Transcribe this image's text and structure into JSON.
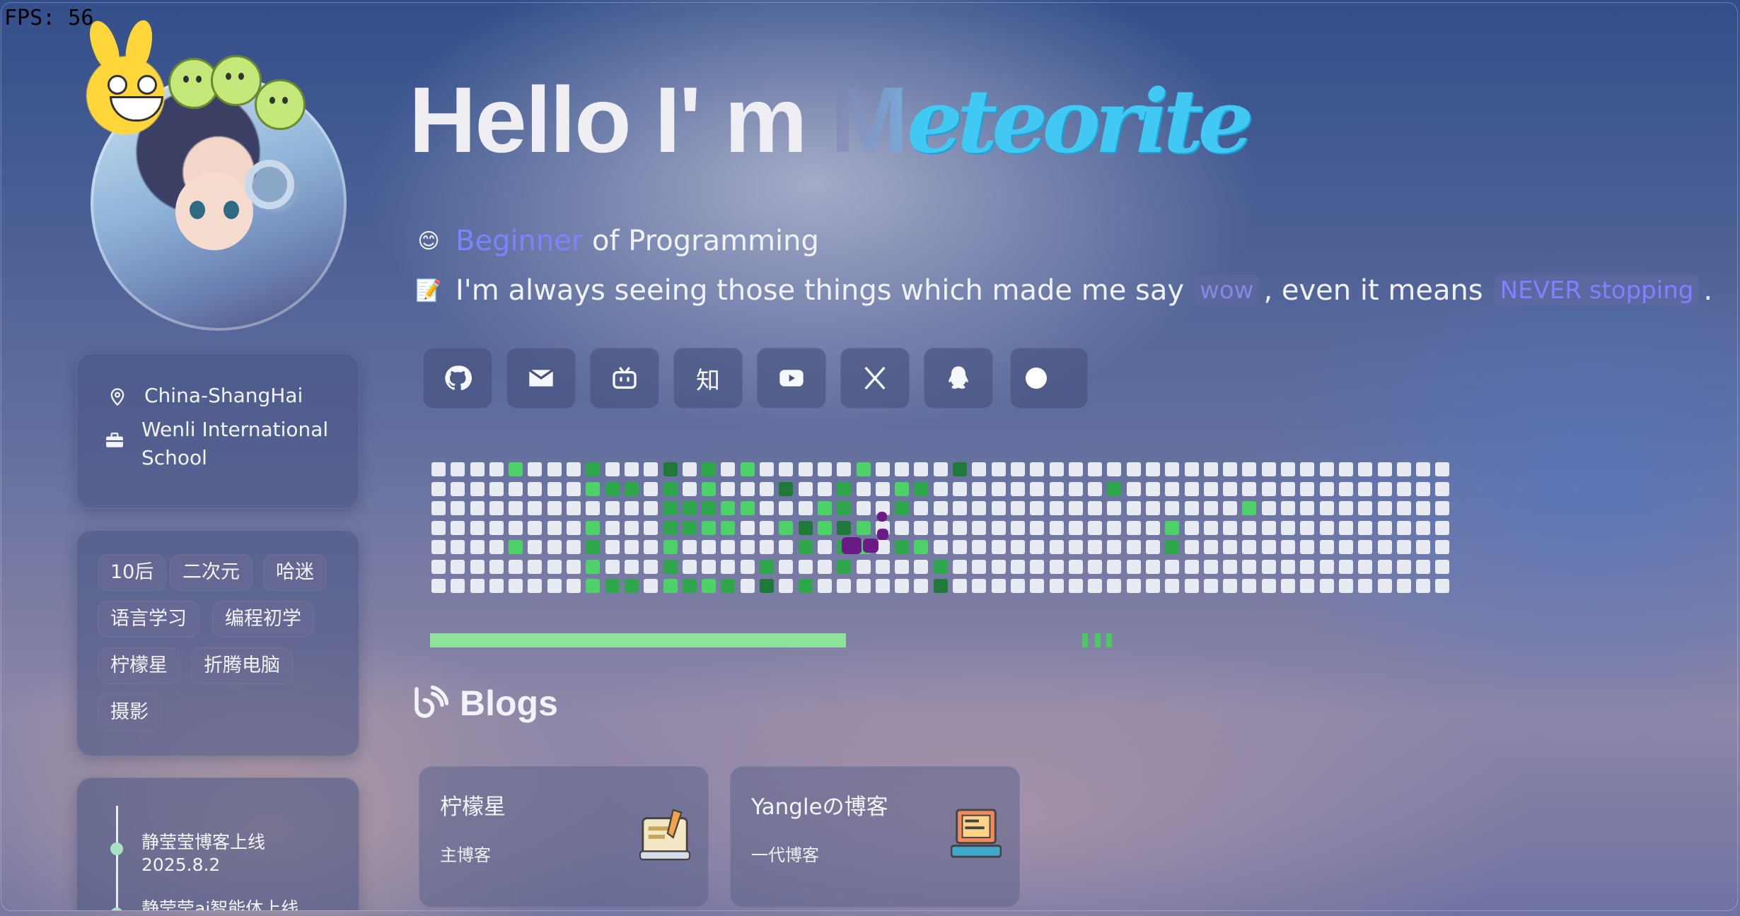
{
  "fps": "FPS: 56",
  "hero": {
    "greeting": "Hello I' m ",
    "name_first_letter": "M",
    "name_rest": "eteorite",
    "line1": {
      "emoji": "😊",
      "highlight": "Beginner",
      "rest": " of Programming"
    },
    "line2": {
      "emoji": "📝",
      "text1": "I'm always seeing those things which made me say",
      "pill1": "wow",
      "text2": ", even it means",
      "pill2": "NEVER stopping",
      "text3": "."
    }
  },
  "profile": {
    "location": "China-ShangHai",
    "school_line1": "Wenli International",
    "school_line2": "School",
    "location_icon": "location-pin-icon",
    "school_icon": "briefcase-icon"
  },
  "tags": [
    "10后",
    "二次元",
    "哈迷",
    "语言学习",
    "编程初学",
    "柠檬星",
    "折腾电脑",
    "摄影"
  ],
  "timeline": [
    {
      "title": "静莹莹博客上线",
      "date": "2025.8.2"
    },
    {
      "title": "静莹莹ai智能体上线",
      "date": ""
    }
  ],
  "social": [
    {
      "name": "github-button",
      "icon": "github-icon"
    },
    {
      "name": "email-button",
      "icon": "mail-icon"
    },
    {
      "name": "bilibili-button",
      "icon": "bilibili-icon"
    },
    {
      "name": "zhihu-button",
      "icon": "zhihu-icon",
      "label": "知"
    },
    {
      "name": "youtube-button",
      "icon": "youtube-icon"
    },
    {
      "name": "x-button",
      "icon": "x-icon"
    },
    {
      "name": "qq-button",
      "icon": "qq-icon"
    },
    {
      "name": "theme-toggle",
      "icon": "toggle-icon"
    }
  ],
  "progress": {
    "percent": 60
  },
  "blogs": {
    "heading": "Blogs",
    "cards": [
      {
        "title": "柠檬星",
        "subtitle": "主博客",
        "icon": "notepad-icon"
      },
      {
        "title": "Yangleの博客",
        "subtitle": "一代博客",
        "icon": "laptop-icon"
      }
    ]
  },
  "colors": {
    "accent_blue": "#7b83ff",
    "name_cyan": "#41c9f3",
    "contrib_light": "#4dd268",
    "contrib_mid": "#2ea64a",
    "contrib_dark": "#1f7a39",
    "snake": "#6a1b86"
  }
}
